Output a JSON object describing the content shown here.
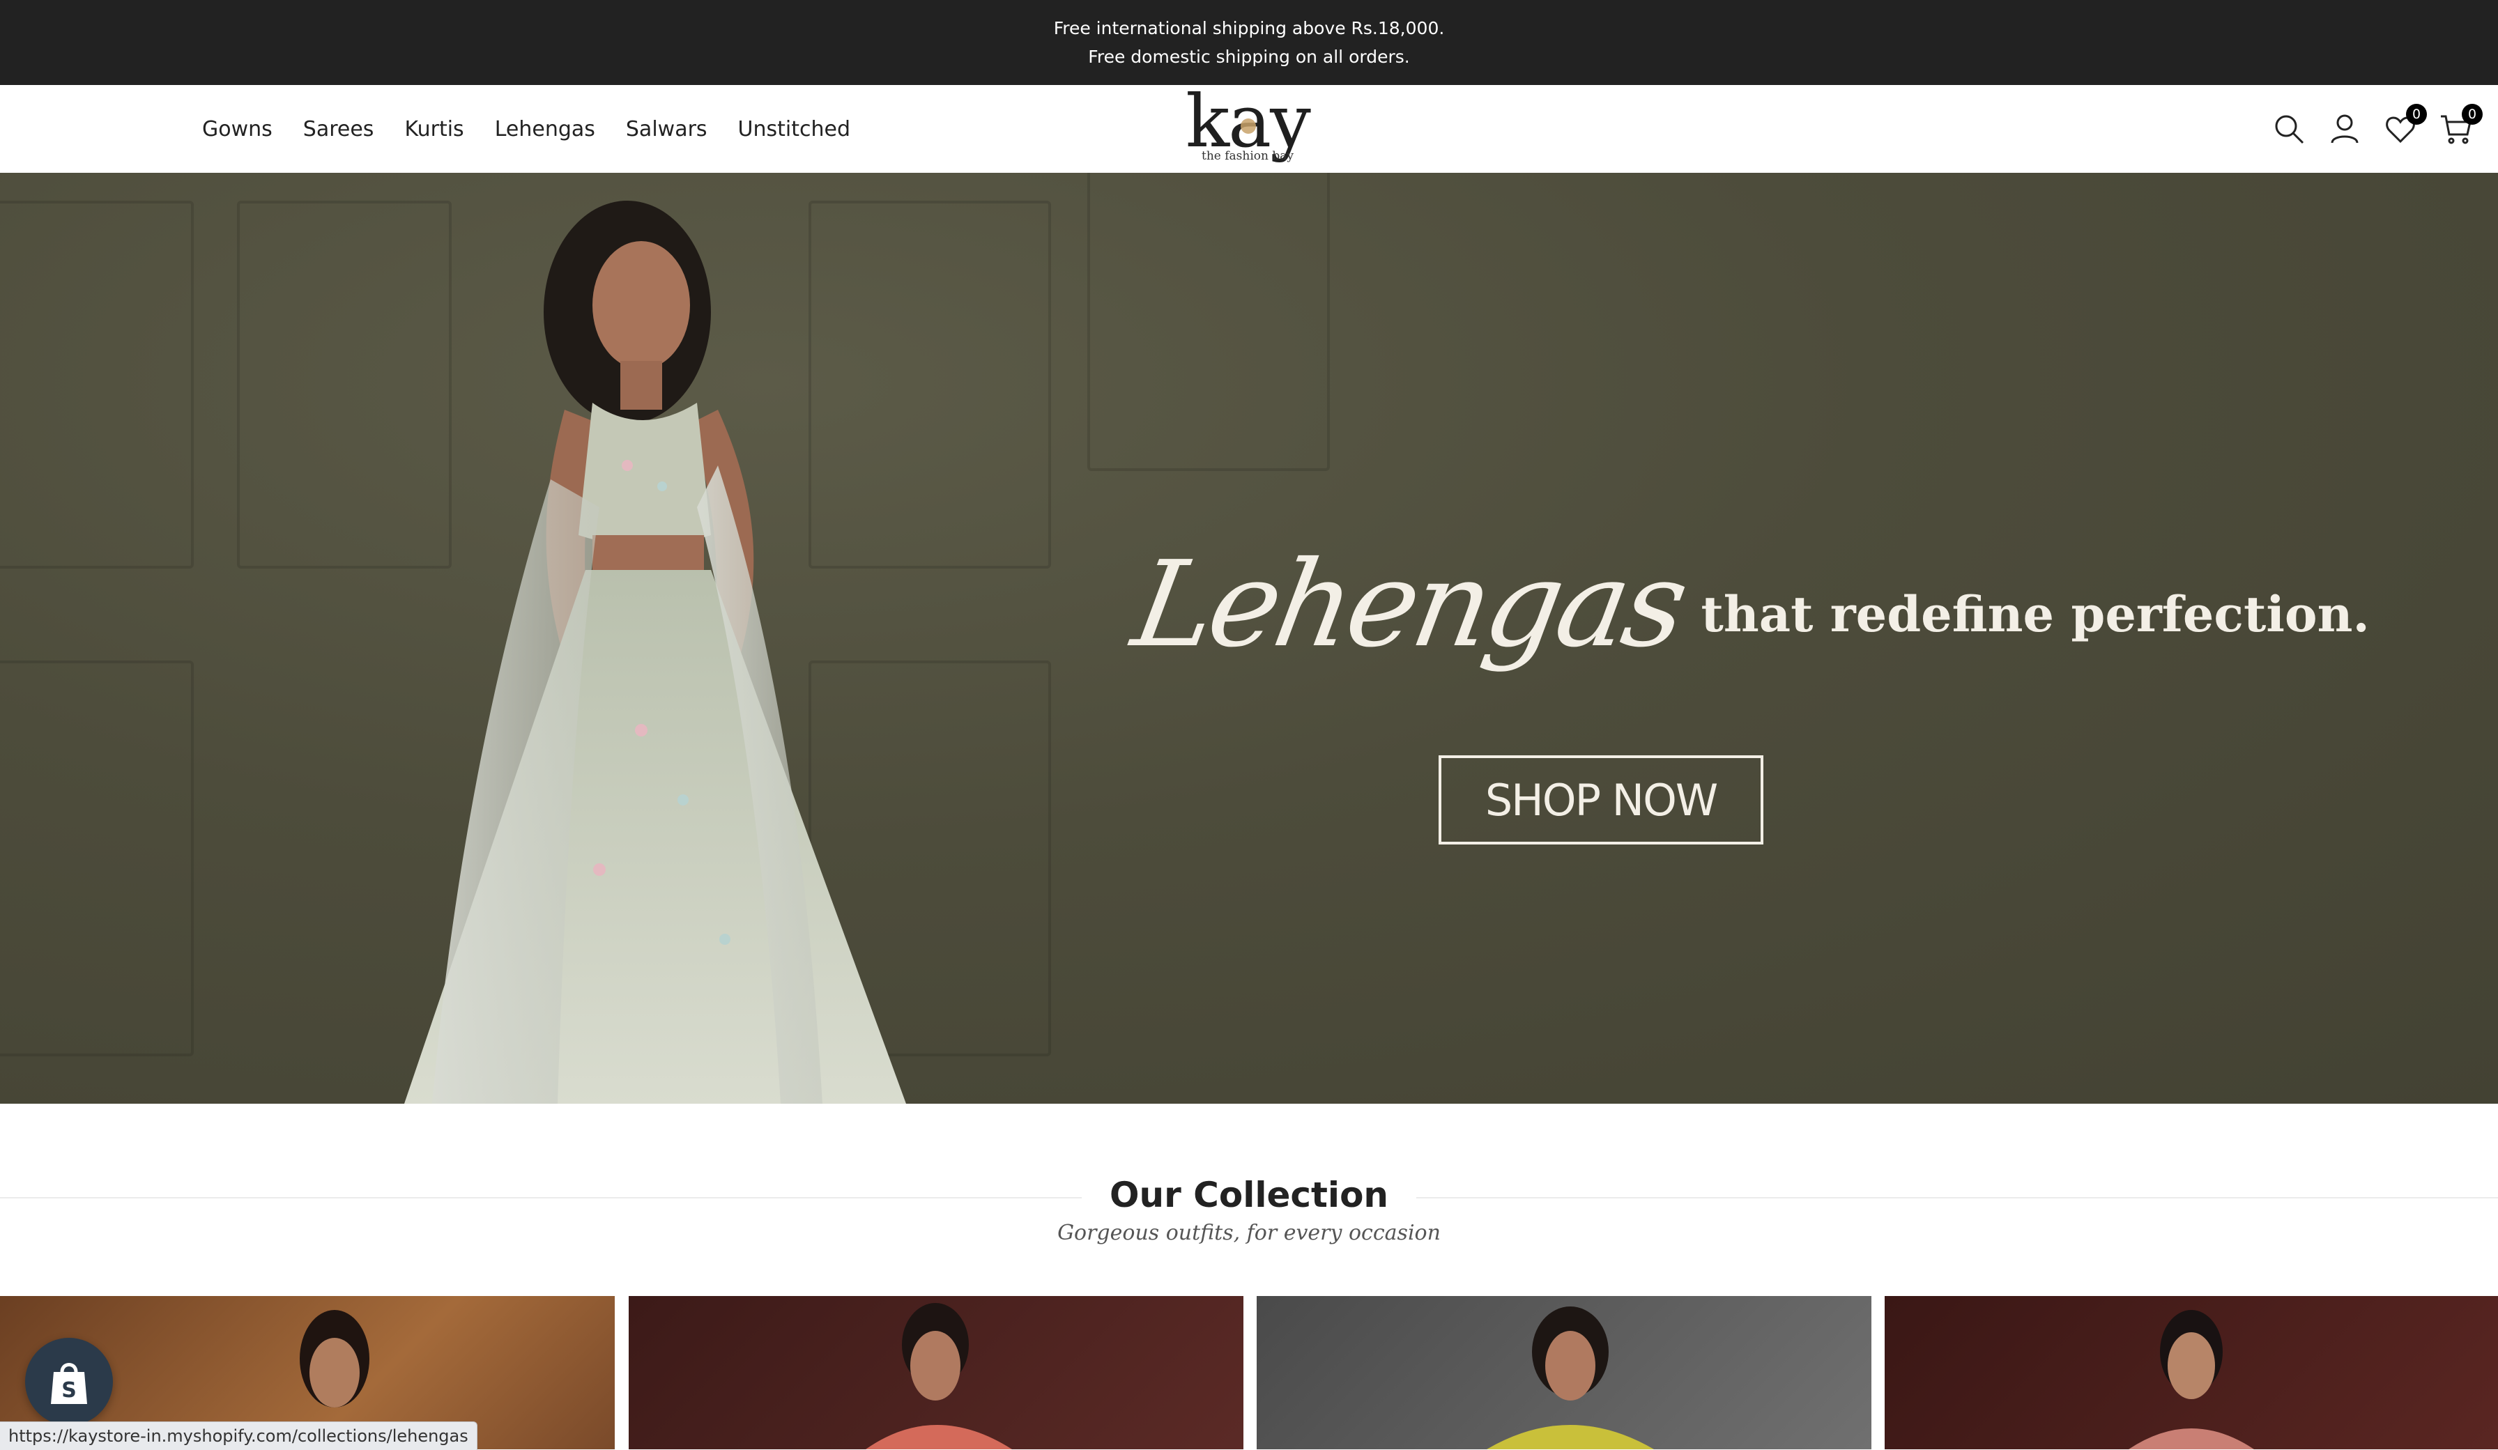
{
  "announcement": {
    "line1": "Free international shipping above Rs.18,000.",
    "line2": "Free domestic shipping on all orders."
  },
  "nav": [
    "Gowns",
    "Sarees",
    "Kurtis",
    "Lehengas",
    "Salwars",
    "Unstitched"
  ],
  "logo": {
    "wordmark": "kay",
    "tagline": "the fashion bay"
  },
  "header_icons": {
    "wishlist_count": "0",
    "cart_count": "0"
  },
  "hero": {
    "script_word": "Lehengas",
    "headline_rest": "that redefine perfection.",
    "cta": "SHOP NOW",
    "bg_color": "#4d4c3b"
  },
  "collection": {
    "title": "Our Collection",
    "subtitle": "Gorgeous outfits, for every occasion"
  },
  "status_bar_url": "https://kaystore-in.myshopify.com/collections/lehengas",
  "accent_color": "#222222"
}
